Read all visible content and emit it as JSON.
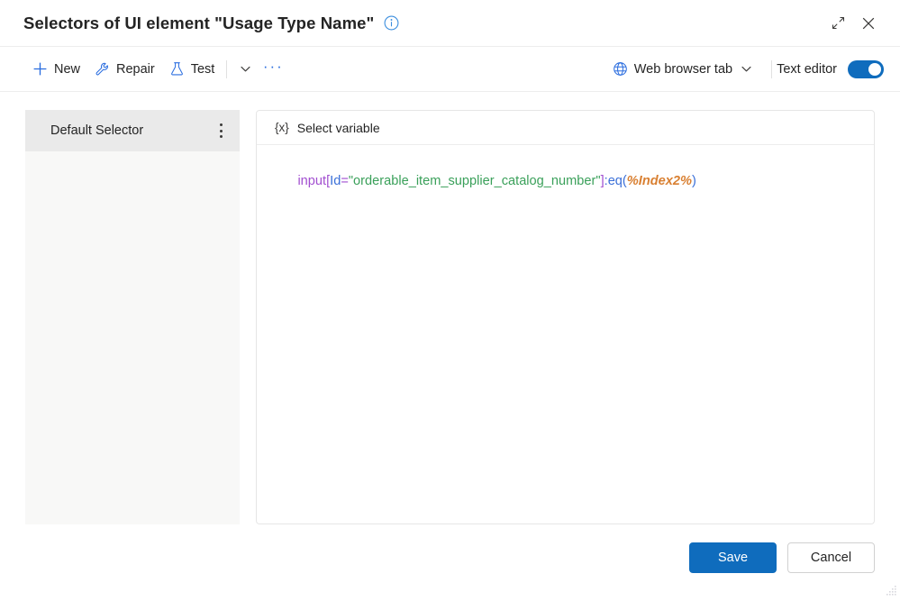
{
  "window": {
    "title": "Selectors of UI element \"Usage Type Name\"",
    "info_icon": "info-circle-icon",
    "expand_icon": "expand-diagonal-icon",
    "close_icon": "close-icon"
  },
  "toolbar": {
    "new_label": "New",
    "new_icon": "plus-icon",
    "repair_label": "Repair",
    "repair_icon": "wrench-icon",
    "test_label": "Test",
    "test_icon": "flask-icon",
    "test_dropdown_icon": "chevron-down-icon",
    "overflow_icon": "ellipsis-horizontal-icon",
    "overflow_label": "···",
    "target_label": "Web browser tab",
    "target_icon": "globe-icon",
    "target_dropdown_icon": "chevron-down-icon",
    "text_editor_label": "Text editor",
    "text_editor_toggle_state": "on",
    "accent_color": "#2a6ddf"
  },
  "selector_list": {
    "items": [
      {
        "label": "Default Selector",
        "selected": true,
        "more_icon": "more-vertical-icon"
      }
    ]
  },
  "editor": {
    "select_variable_label": "Select variable",
    "variable_glyph": "{x}",
    "code": {
      "full_text": "input[Id=\"orderable_item_supplier_catalog_number\"]:eq(%Index2%)",
      "tokens": [
        {
          "text": "input",
          "type": "tag",
          "color": "#a24fd0"
        },
        {
          "text": "[",
          "type": "punct",
          "color": "#a24fd0"
        },
        {
          "text": "Id",
          "type": "attr",
          "color": "#3a6fd8"
        },
        {
          "text": "=",
          "type": "punct",
          "color": "#a24fd0"
        },
        {
          "text": "\"orderable_item_supplier_catalog_number\"",
          "type": "string",
          "color": "#3aa05a"
        },
        {
          "text": "]",
          "type": "punct",
          "color": "#a24fd0"
        },
        {
          "text": ":eq(",
          "type": "pseudo",
          "color": "#3a6fd8"
        },
        {
          "text": "%Index2%",
          "type": "variable",
          "color": "#d98032"
        },
        {
          "text": ")",
          "type": "pseudo",
          "color": "#3a6fd8"
        }
      ]
    }
  },
  "footer": {
    "save_label": "Save",
    "cancel_label": "Cancel",
    "primary_color": "#0f6cbd"
  }
}
